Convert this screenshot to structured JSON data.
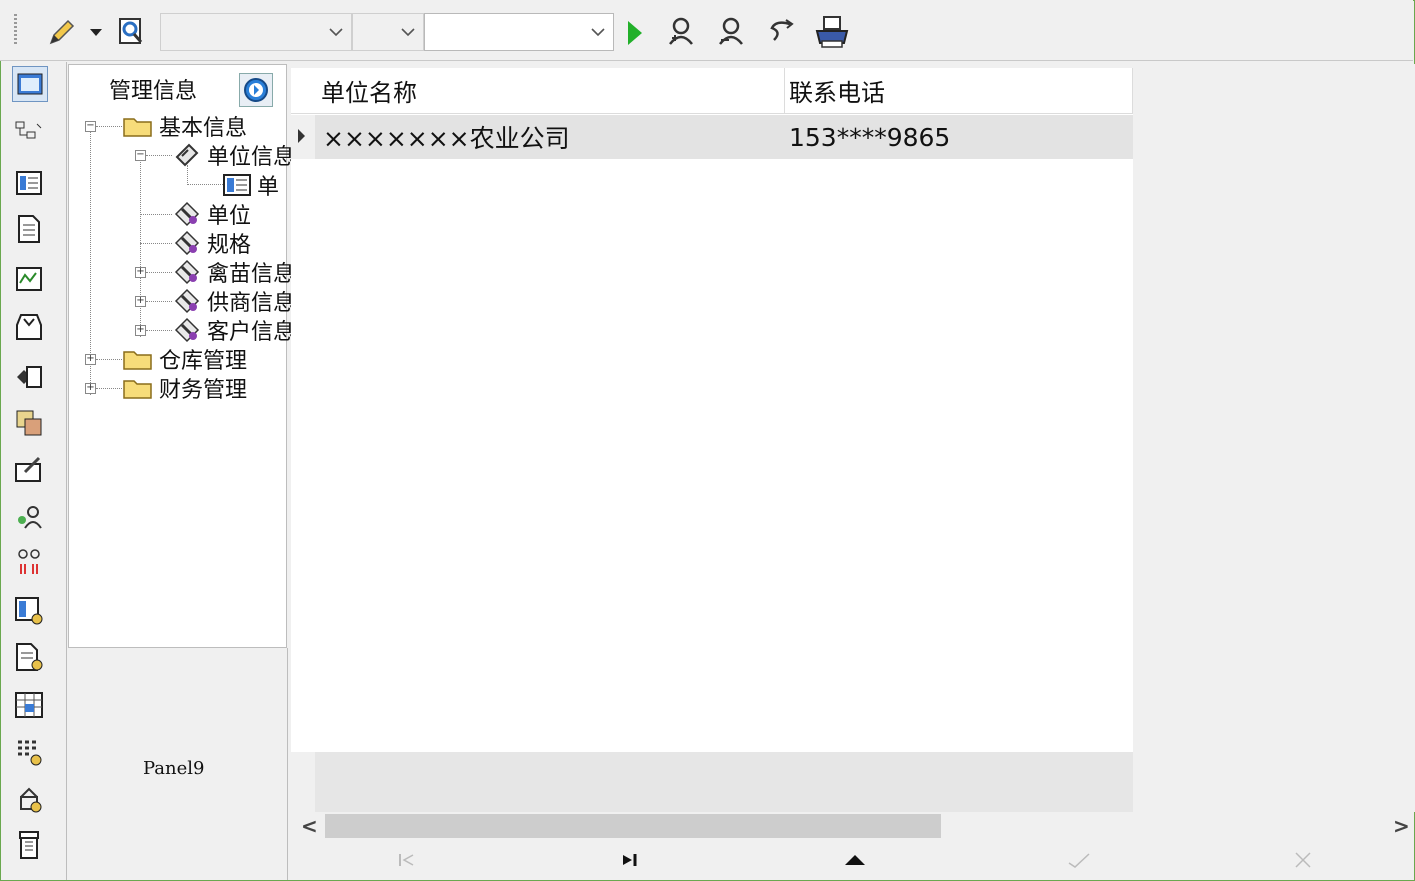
{
  "toolbar": {
    "combo1_value": "",
    "combo2_value": "",
    "combo3_value": "",
    "colors": {
      "run": "#22b02a",
      "print": "#3a5aa8"
    }
  },
  "left_icons": [
    "form-icon",
    "hierarchy-icon",
    "list-icon",
    "document-icon",
    "chart-icon",
    "inbox-icon",
    "module-icon",
    "grid-icon",
    "edit-icon",
    "users-icon",
    "glasses-icon",
    "report-icon",
    "page-report-icon",
    "table-icon",
    "calculator-icon",
    "worker-icon",
    "trash-icon"
  ],
  "tree": {
    "title": "管理信息",
    "nodes": [
      {
        "label": "基本信息",
        "icon": "folder-icon"
      },
      {
        "label": "单位信息",
        "icon": "tools-icon"
      },
      {
        "label": "单",
        "icon": "list-icon"
      },
      {
        "label": "单位",
        "icon": "wrench-icon"
      },
      {
        "label": "规格",
        "icon": "wrench-icon"
      },
      {
        "label": "禽苗信息",
        "icon": "wrench-icon"
      },
      {
        "label": "供商信息",
        "icon": "wrench-icon"
      },
      {
        "label": "客户信息",
        "icon": "wrench-icon"
      },
      {
        "label": "仓库管理",
        "icon": "folder-icon"
      },
      {
        "label": "财务管理",
        "icon": "folder-icon"
      }
    ]
  },
  "panel9": {
    "label": "Panel9"
  },
  "grid": {
    "columns": [
      "单位名称",
      "联系电话"
    ],
    "rows": [
      [
        "×××××××农业公司",
        "153****9865"
      ]
    ]
  }
}
